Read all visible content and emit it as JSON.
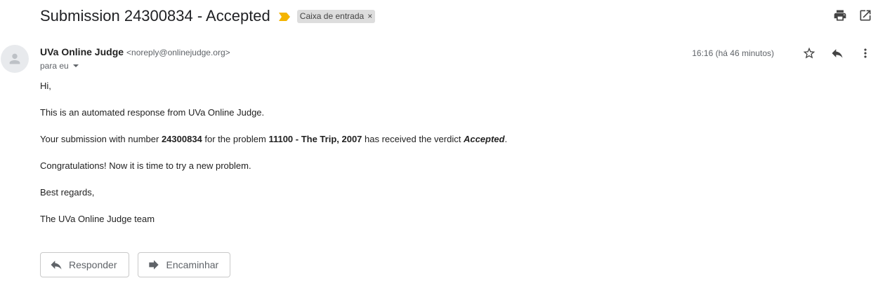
{
  "email": {
    "subject": "Submission 24300834 - Accepted",
    "label": "Caixa de entrada",
    "label_remove": "×",
    "sender_name": "UVa Online Judge",
    "sender_email": "<noreply@onlinejudge.org>",
    "to": "para eu",
    "time": "16:16 (há 46 minutos)"
  },
  "body": {
    "greeting": "Hi,",
    "intro": "This is an automated response from UVa Online Judge.",
    "submission_pre": "Your submission with number ",
    "submission_number": "24300834",
    "submission_mid": " for the problem ",
    "problem": "11100 - The Trip, 2007",
    "submission_post": " has received the verdict ",
    "verdict": "Accepted",
    "submission_end": ".",
    "congrats": "Congratulations! Now it is time to try a new problem.",
    "closing": "Best regards,",
    "signature": "The UVa Online Judge team"
  },
  "actions": {
    "reply": "Responder",
    "forward": "Encaminhar"
  },
  "icons": {
    "importance": "importance-marker-icon",
    "print": "print-icon",
    "open_new_window": "open-in-new-icon",
    "star": "star-icon",
    "reply": "reply-icon",
    "more": "more-vert-icon",
    "forward": "forward-icon",
    "avatar": "person-icon"
  },
  "colors": {
    "importance": "#f4b400",
    "label_bg": "#dddddd",
    "text": "#222222",
    "muted": "#5f6368"
  }
}
